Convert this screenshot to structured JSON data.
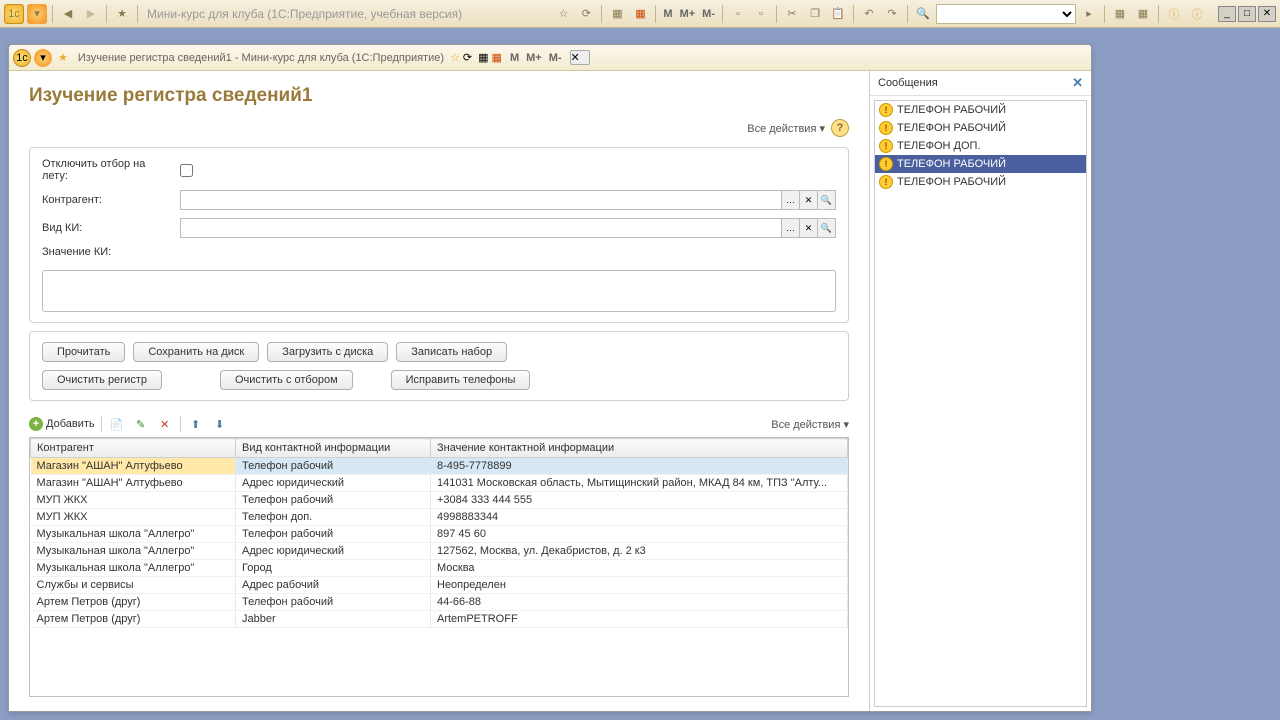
{
  "outerTitle": "Мини-курс для клуба  (1С:Предприятие, учебная версия)",
  "subTitle": "Изучение регистра сведений1 - Мини-курс для клуба  (1С:Предприятие)",
  "pageTitle": "Изучение регистра сведений1",
  "topActions": {
    "allActions": "Все действия",
    "help": "?"
  },
  "form": {
    "disableFilterLabel": "Отключить отбор на лету:",
    "counterpartyLabel": "Контрагент:",
    "counterpartyValue": "",
    "kindLabel": "Вид КИ:",
    "kindValue": "",
    "valueLabel": "Значение КИ:"
  },
  "buttons": {
    "read": "Прочитать",
    "saveDisk": "Сохранить на диск",
    "loadDisk": "Загрузить с диска",
    "writeSet": "Записать набор",
    "clearReg": "Очистить регистр",
    "clearFilter": "Очистить с отбором",
    "fixPhones": "Исправить телефоны"
  },
  "tableToolbar": {
    "add": "Добавить",
    "allActions": "Все действия"
  },
  "tableCols": {
    "c1": "Контрагент",
    "c2": "Вид контактной информации",
    "c3": "Значение контактной информации"
  },
  "rows": [
    {
      "c1": "Магазин \"АШАН\" Алтуфьево",
      "c2": "Телефон рабочий",
      "c3": "8-495-7778899",
      "sel": true
    },
    {
      "c1": "Магазин \"АШАН\" Алтуфьево",
      "c2": "Адрес юридический",
      "c3": "141031 Московская область, Мытищинский район, МКАД 84 км, ТПЗ \"Алту..."
    },
    {
      "c1": "МУП ЖКХ",
      "c2": "Телефон рабочий",
      "c3": "+3084 333 444 555"
    },
    {
      "c1": "МУП ЖКХ",
      "c2": "Телефон доп.",
      "c3": "4998883344"
    },
    {
      "c1": "Музыкальная школа \"Аллегро\"",
      "c2": "Телефон рабочий",
      "c3": "897 45 60"
    },
    {
      "c1": "Музыкальная школа \"Аллегро\"",
      "c2": "Адрес юридический",
      "c3": "127562, Москва, ул. Декабристов, д. 2 к3"
    },
    {
      "c1": "Музыкальная школа \"Аллегро\"",
      "c2": "Город",
      "c3": "Москва"
    },
    {
      "c1": "Службы и сервисы",
      "c2": "Адрес рабочий",
      "c3": "Неопределен"
    },
    {
      "c1": "Артем Петров (друг)",
      "c2": "Телефон рабочий",
      "c3": "44-66-88"
    },
    {
      "c1": "Артем Петров (друг)",
      "c2": "Jabber",
      "c3": "ArtemPETROFF"
    }
  ],
  "messages": {
    "header": "Сообщения",
    "items": [
      {
        "text": "ТЕЛЕФОН РАБОЧИЙ"
      },
      {
        "text": "ТЕЛЕФОН РАБОЧИЙ"
      },
      {
        "text": "ТЕЛЕФОН ДОП."
      },
      {
        "text": "ТЕЛЕФОН РАБОЧИЙ",
        "sel": true
      },
      {
        "text": "ТЕЛЕФОН РАБОЧИЙ"
      }
    ]
  },
  "mLabels": {
    "m": "M",
    "mPlus": "M+",
    "mMinus": "M-"
  }
}
